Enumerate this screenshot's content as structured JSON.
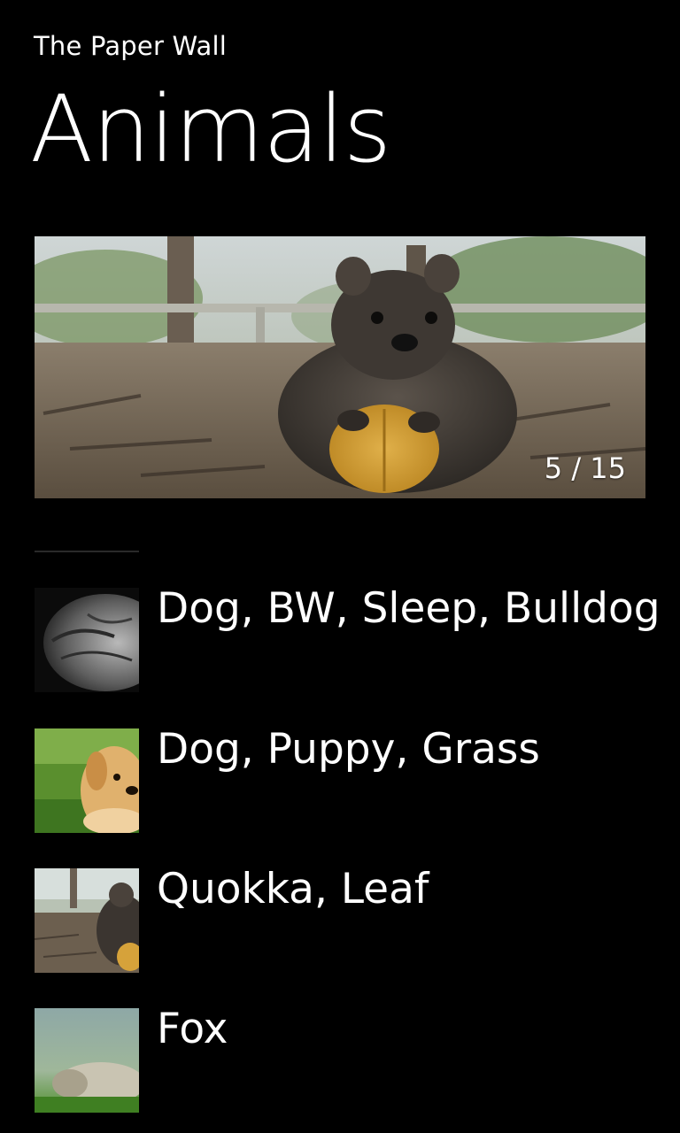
{
  "header": {
    "app_title": "The Paper Wall",
    "page_title": "Animals"
  },
  "hero": {
    "image_subject": "quokka-holding-leaf",
    "counter": "5 / 15"
  },
  "list": {
    "items": [
      {
        "label": "Dog, BW, Sleep, Bulldog",
        "thumb": "bulldog-bw"
      },
      {
        "label": "Dog, Puppy, Grass",
        "thumb": "puppy-grass"
      },
      {
        "label": "Quokka, Leaf",
        "thumb": "quokka-leaf"
      },
      {
        "label": "Fox",
        "thumb": "fox"
      }
    ]
  },
  "colors": {
    "background": "#000000",
    "text": "#ffffff"
  }
}
